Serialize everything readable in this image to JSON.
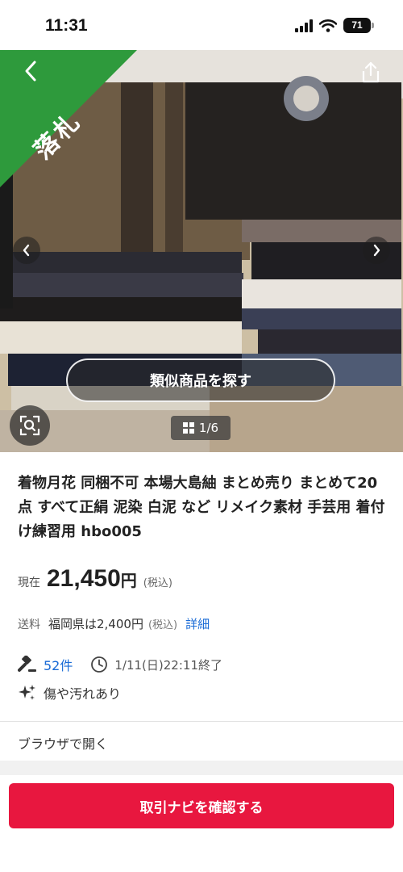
{
  "status_bar": {
    "time": "11:31",
    "battery": "71"
  },
  "hero": {
    "ribbon_label": "落札",
    "similar_button_label": "類似商品を探す",
    "image_counter": "1/6"
  },
  "item": {
    "title": "着物月花 同梱不可 本場大島紬 まとめ売り まとめて20点 すべて正絹 泥染 白泥 など リメイク素材 手芸用 着付け練習用 hbo005",
    "price_label": "現在",
    "price_value": "21,450",
    "price_unit": "円",
    "price_tax": "(税込)",
    "shipping_label": "送料",
    "shipping_value": "福岡県は2,400円",
    "shipping_tax": "(税込)",
    "shipping_detail_link": "詳細",
    "bid_count": "52件",
    "end_time": "1/11(日)22:11終了",
    "condition": "傷や汚れあり"
  },
  "browser_link": "ブラウザで開く",
  "cta_label": "取引ナビを確認する",
  "colors": {
    "ribbon": "#2e9a3c",
    "cta": "#e8173f",
    "link": "#1a6bd6"
  }
}
